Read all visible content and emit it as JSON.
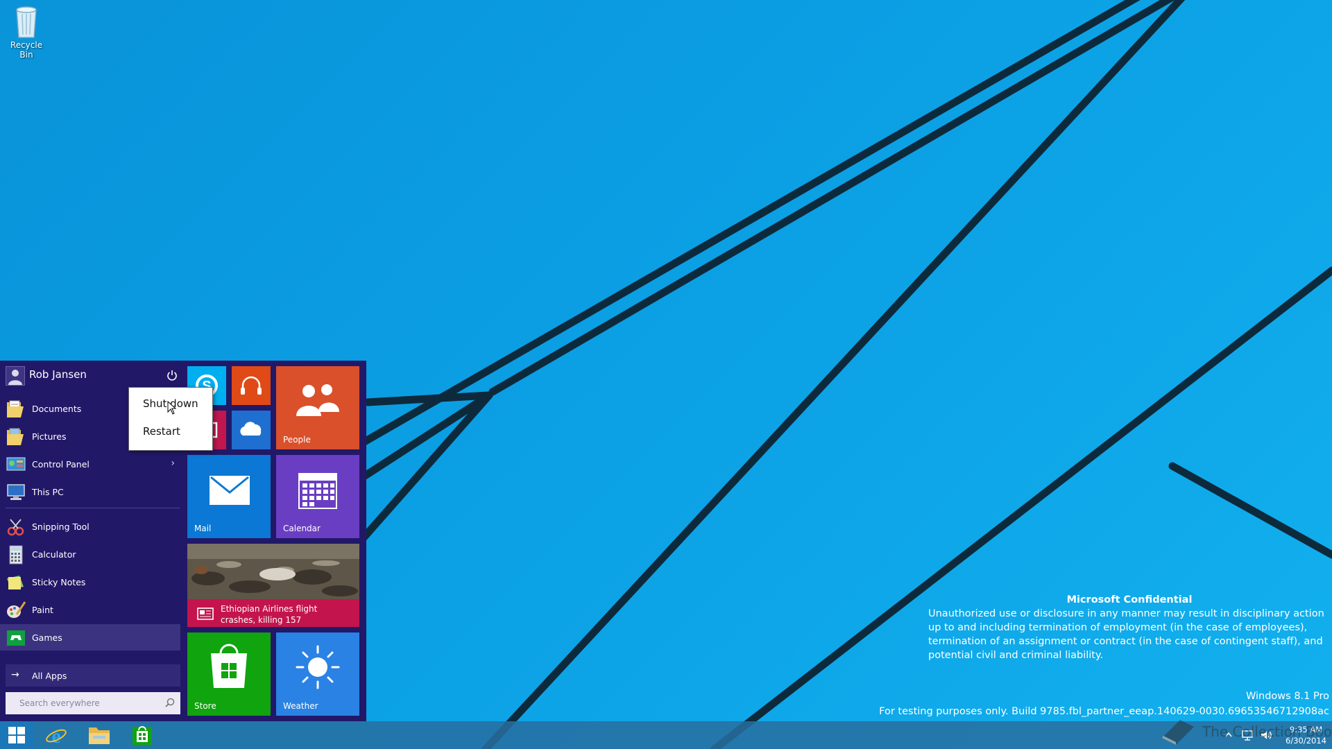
{
  "desktop": {
    "recycle_bin_label": "Recycle Bin"
  },
  "watermark": {
    "title": "Microsoft Confidential",
    "body": "Unauthorized use or disclosure in any manner may result in disciplinary action up to and including termination of employment (in the case of employees), termination of an assignment or contract (in the case of contingent staff), and potential civil and criminal liability.",
    "edition": "Windows 8.1 Pro",
    "build": "For testing purposes only. Build 9785.fbl_partner_eeap.140629-0030.69653546712908ac"
  },
  "start_menu": {
    "user_name": "Rob Jansen",
    "places": [
      {
        "label": "Documents",
        "icon": "folder-documents-icon"
      },
      {
        "label": "Pictures",
        "icon": "folder-pictures-icon"
      },
      {
        "label": "Control Panel",
        "icon": "control-panel-icon",
        "has_submenu": true
      },
      {
        "label": "This PC",
        "icon": "computer-icon"
      }
    ],
    "apps": [
      {
        "label": "Snipping Tool",
        "icon": "scissors-icon"
      },
      {
        "label": "Calculator",
        "icon": "calculator-icon"
      },
      {
        "label": "Sticky Notes",
        "icon": "sticky-notes-icon"
      },
      {
        "label": "Paint",
        "icon": "paint-icon"
      },
      {
        "label": "Games",
        "icon": "gamepad-icon",
        "highlighted": true
      }
    ],
    "all_apps_label": "All Apps",
    "search_placeholder": "Search everywhere",
    "power_menu": {
      "items": [
        "Shut down",
        "Restart"
      ]
    }
  },
  "tiles": {
    "people": "People",
    "mail": "Mail",
    "calendar": "Calendar",
    "news": "Ethiopian Airlines flight crashes, killing 157",
    "store": "Store",
    "weather": "Weather",
    "colors": {
      "skype": "#00aff0",
      "music": "#e04a16",
      "people": "#d9502b",
      "video": "#c0174f",
      "onedrive": "#1f6fd1",
      "mail": "#0a78d4",
      "calendar": "#6a3ec2",
      "news": "#c4144e",
      "store": "#10a40e",
      "weather": "#2a82e4"
    }
  },
  "taskbar": {
    "pinned": [
      "internet-explorer-icon",
      "file-explorer-icon",
      "store-icon"
    ],
    "time": "9:35 AM",
    "date": "6/30/2014",
    "watermark_text": "The Collection Book"
  }
}
